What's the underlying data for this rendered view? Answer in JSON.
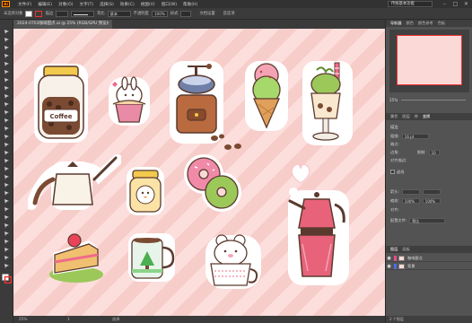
{
  "app": {
    "logo_text": "Ai",
    "menus": [
      "文件(F)",
      "编辑(E)",
      "对象(O)",
      "文字(T)",
      "选择(S)",
      "效果(C)",
      "视图(V)",
      "窗口(W)",
      "帮助(H)"
    ],
    "workspace": "传统基本功能",
    "win_min": "–",
    "win_max": "□",
    "win_close": "✕"
  },
  "control_bar": {
    "selection_label": "未选择对象",
    "stroke_label": "描边",
    "stroke_profile": "等比",
    "brush": "基本",
    "opacity_label": "不透明度",
    "opacity_value": "100%",
    "style_label": "样式",
    "doc_setup": "文档设置",
    "preferences": "首选项"
  },
  "document": {
    "tab_title": "2024-0703咖啡甜点.ai @ 25% (RGB/GPU 预览)",
    "tab_close": "✕"
  },
  "status_bar": {
    "zoom": "25%",
    "artboard": "1",
    "tool": "选择"
  },
  "right_panel": {
    "top_tabs": [
      "导航器",
      "颜色",
      "颜色参考",
      "色板",
      "画笔",
      "符号"
    ],
    "zoom_value": "25%",
    "transform_tabs": [
      "属性",
      "图层",
      "库",
      "变换",
      "对齐",
      "路径查找器"
    ],
    "stroke_section_title": "描边",
    "weight_label": "粗细:",
    "weight_value": "16 pt",
    "cap_label": "端点:",
    "corner_label": "边角:",
    "limit_label": "限制:",
    "limit_value": "10",
    "align_label": "对齐描边:",
    "dash_label": "虚线",
    "arrow_label": "箭头:",
    "scale_label": "缩放:",
    "scale_value": "100%",
    "align2_label": "对齐:",
    "profile_label": "配置文件:",
    "profile_value": "等比",
    "layers_tabs": [
      "图层",
      "画板"
    ],
    "layers": [
      {
        "name": "咖啡甜点",
        "color": "#e64d8b"
      },
      {
        "name": "背景",
        "color": "#4d6ce6"
      }
    ],
    "layers_footer": "2 个图层"
  },
  "colors": {
    "canvas_bg": "#fbd9d6",
    "accent_orange": "#ff9a00",
    "stroke_dark": "#5b3a2e"
  }
}
